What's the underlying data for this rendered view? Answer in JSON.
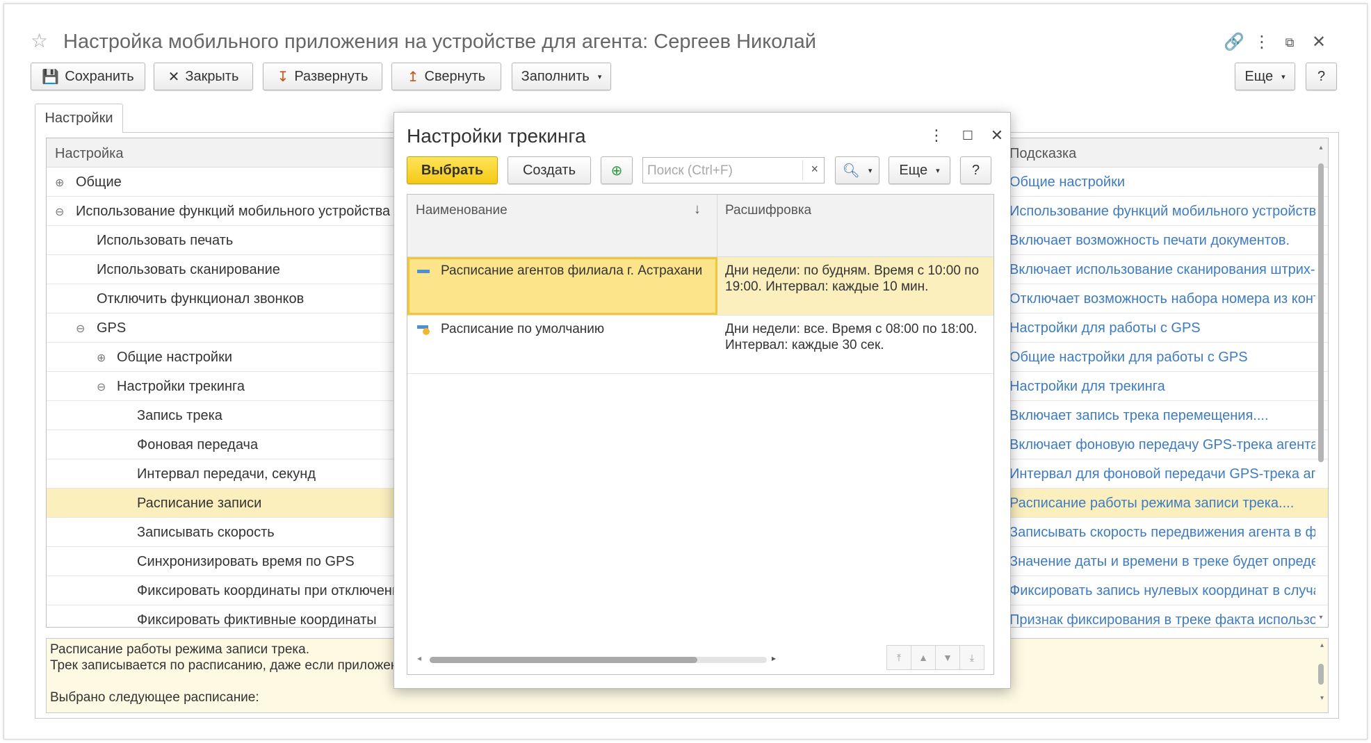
{
  "window": {
    "title": "Настройка мобильного приложения на устройстве для агента: Сергеев Николай"
  },
  "toolbar": {
    "save": "Сохранить",
    "close": "Закрыть",
    "expand": "Развернуть",
    "collapse": "Свернуть",
    "fill": "Заполнить",
    "more": "Еще",
    "help": "?"
  },
  "tabs": [
    "Настройки"
  ],
  "settings_table": {
    "columns": [
      "Настройка",
      "Подсказка"
    ],
    "rows": [
      {
        "label": "Общие",
        "toggle": "⊕",
        "hint": "Общие настройки"
      },
      {
        "label": "Использование функций мобильного устройства",
        "toggle": "⊖",
        "hint": "Использование функций мобильного устройства"
      },
      {
        "label": "Использовать печать",
        "toggle": "",
        "hint": "Включает возможность печати документов."
      },
      {
        "label": "Использовать сканирование",
        "toggle": "",
        "hint": "Включает использование сканирования штрих-ко..."
      },
      {
        "label": "Отключить функционал звонков",
        "toggle": "",
        "hint": "Отключает возможность набора номера из конте..."
      },
      {
        "label": "GPS",
        "toggle": "⊖",
        "hint": "Настройки для работы с GPS"
      },
      {
        "label": "Общие настройки",
        "toggle": "⊕",
        "hint": "Общие настройки для работы с GPS"
      },
      {
        "label": "Настройки трекинга",
        "toggle": "⊖",
        "hint": "Настройки для трекинга"
      },
      {
        "label": "Запись трека",
        "toggle": "",
        "hint": "Включает запись трека перемещения...."
      },
      {
        "label": "Фоновая передача",
        "toggle": "",
        "hint": "Включает фоновую передачу GPS-трека агента ..."
      },
      {
        "label": "Интервал передачи, секунд",
        "toggle": "",
        "hint": "Интервал для фоновой передачи GPS-трека аге..."
      },
      {
        "label": "Расписание записи",
        "toggle": "",
        "hint": "Расписание работы режима записи трека...."
      },
      {
        "label": "Записывать скорость",
        "toggle": "",
        "hint": "Записывать скорость передвижения агента в фа..."
      },
      {
        "label": "Синхронизировать время по GPS",
        "toggle": "",
        "hint": "Значение даты и времени в треке будет определ..."
      },
      {
        "label": "Фиксировать координаты при отключении",
        "toggle": "",
        "hint": "Фиксировать запись нулевых координат в случа..."
      },
      {
        "label": "Фиксировать фиктивные координаты",
        "toggle": "",
        "hint": "Признак фиксирования в треке факта использов..."
      }
    ]
  },
  "info_panel": {
    "lines": [
      "Расписание работы режима записи трека.",
      "Трек записывается по расписанию, даже если приложение",
      "",
      "Выбрано следующее расписание:"
    ]
  },
  "dialog": {
    "title": "Настройки трекинга",
    "choose": "Выбрать",
    "create": "Создать",
    "search_placeholder": "Поиск (Ctrl+F)",
    "clear": "×",
    "more": "Еще",
    "help": "?",
    "columns": [
      "Наименование",
      "Расшифровка"
    ],
    "sort_icon": "↓",
    "rows": [
      {
        "name": "Расписание агентов филиала г. Астрахани",
        "descr_1": "Дни недели: по будням. Время с 10:00 по",
        "descr_2": "19:00. Интервал: каждые 10 мин."
      },
      {
        "name": "Расписание по умолчанию",
        "descr_1": "Дни недели: все. Время с 08:00 по 18:00.",
        "descr_2": "Интервал: каждые 30 сек."
      }
    ]
  },
  "colors": {
    "selection": "#fbefbe",
    "hint_link": "#3e7bc0",
    "primary_button": "#f4c915"
  }
}
